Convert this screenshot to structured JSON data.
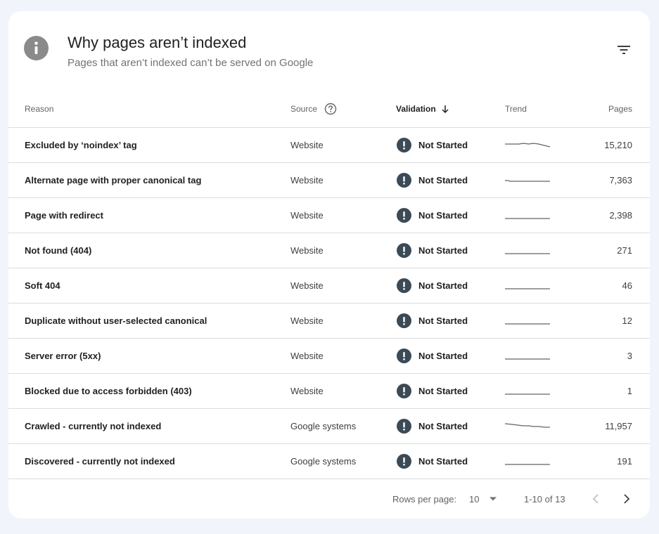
{
  "header": {
    "title": "Why pages aren’t indexed",
    "subtitle": "Pages that aren’t indexed can’t be served on Google",
    "info_icon": "info-icon",
    "filter_icon": "filter-icon"
  },
  "table": {
    "columns": {
      "reason": "Reason",
      "source": "Source",
      "validation": "Validation",
      "trend": "Trend",
      "pages": "Pages"
    },
    "sorted_column": "Validation",
    "sort_direction": "descending",
    "rows": [
      {
        "reason": "Excluded by ‘noindex’ tag",
        "source": "Website",
        "validation": "Not Started",
        "pages": "15,210",
        "trend_shape": "dip-end"
      },
      {
        "reason": "Alternate page with proper canonical tag",
        "source": "Website",
        "validation": "Not Started",
        "pages": "7,363",
        "trend_shape": "flat-dip"
      },
      {
        "reason": "Page with redirect",
        "source": "Website",
        "validation": "Not Started",
        "pages": "2,398",
        "trend_shape": "flat"
      },
      {
        "reason": "Not found (404)",
        "source": "Website",
        "validation": "Not Started",
        "pages": "271",
        "trend_shape": "flat"
      },
      {
        "reason": "Soft 404",
        "source": "Website",
        "validation": "Not Started",
        "pages": "46",
        "trend_shape": "flat"
      },
      {
        "reason": "Duplicate without user-selected canonical",
        "source": "Website",
        "validation": "Not Started",
        "pages": "12",
        "trend_shape": "flat"
      },
      {
        "reason": "Server error (5xx)",
        "source": "Website",
        "validation": "Not Started",
        "pages": "3",
        "trend_shape": "flat"
      },
      {
        "reason": "Blocked due to access forbidden (403)",
        "source": "Website",
        "validation": "Not Started",
        "pages": "1",
        "trend_shape": "flat"
      },
      {
        "reason": "Crawled - currently not indexed",
        "source": "Google systems",
        "validation": "Not Started",
        "pages": "11,957",
        "trend_shape": "decline"
      },
      {
        "reason": "Discovered - currently not indexed",
        "source": "Google systems",
        "validation": "Not Started",
        "pages": "191",
        "trend_shape": "flat"
      }
    ]
  },
  "footer": {
    "rows_per_page_label": "Rows per page:",
    "rows_per_page_value": "10",
    "range": "1-10 of 13"
  },
  "colors": {
    "page_background": "#f1f4fb",
    "card_background": "#ffffff",
    "alert_icon": "#3c4a56",
    "divider": "#dadce0",
    "sparkline": "#5f6368"
  }
}
